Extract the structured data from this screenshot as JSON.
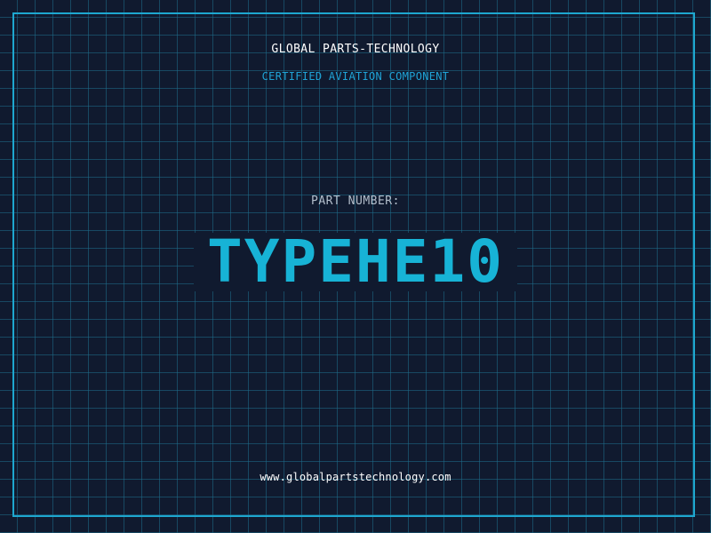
{
  "header": {
    "company": "GLOBAL PARTS-TECHNOLOGY",
    "subtitle": "CERTIFIED AVIATION COMPONENT"
  },
  "part": {
    "label": "PART NUMBER:",
    "number": "TYPEHE10"
  },
  "footer": {
    "url": "www.globalpartstechnology.com"
  },
  "colors": {
    "background": "#101a2f",
    "grid": "#1e6e8c",
    "frame": "#1ea7cf",
    "accent": "#17b3d6",
    "subtitle": "#1fa3d6",
    "label": "#b4bfcc",
    "text": "#ffffff"
  }
}
